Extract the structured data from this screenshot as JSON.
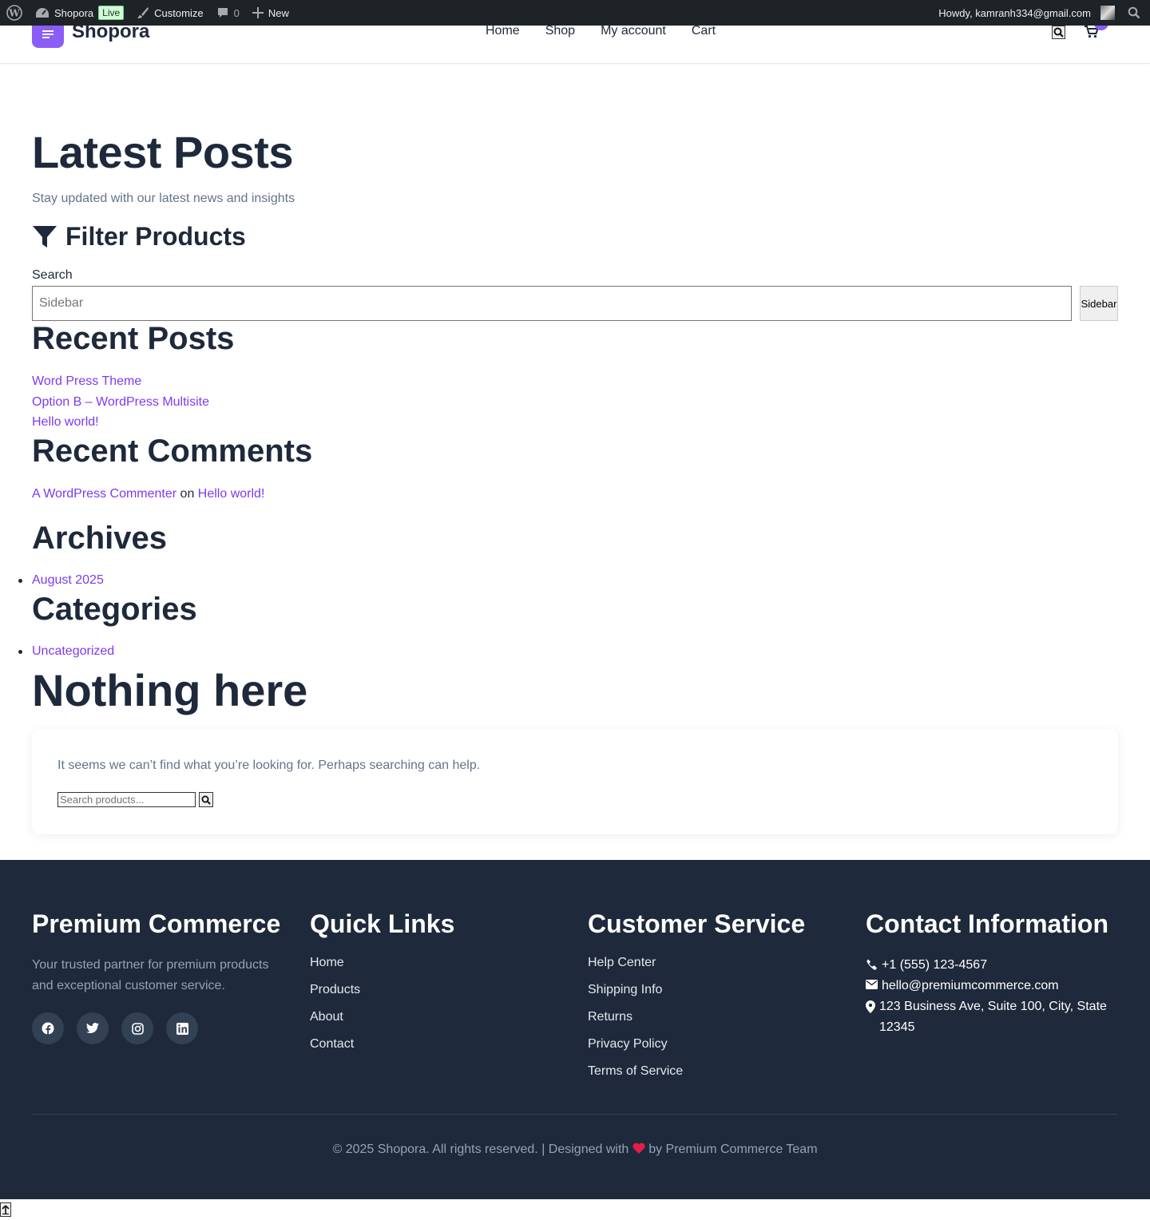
{
  "adminbar": {
    "site_name": "Shopora",
    "live_badge": "Live",
    "customize": "Customize",
    "comments_count": "0",
    "new": "New",
    "howdy": "Howdy, kamranh334@gmail.com"
  },
  "header": {
    "logo": "Shopora",
    "nav": [
      "Home",
      "Shop",
      "My account",
      "Cart"
    ]
  },
  "main": {
    "title": "Latest Posts",
    "subtitle": "Stay updated with our latest news and insights",
    "filter_heading": "Filter Products",
    "search_label": "Search",
    "search_placeholder": "Sidebar",
    "search_button": "Sidebar",
    "recent_posts_heading": "Recent Posts",
    "recent_posts": [
      "Word Press Theme",
      "Option B – WordPress Multisite",
      "Hello world!"
    ],
    "recent_comments_heading": "Recent Comments",
    "comment_author": "A WordPress Commenter",
    "comment_on": "on",
    "comment_post": "Hello world!",
    "archives_heading": "Archives",
    "archives": [
      "August 2025"
    ],
    "categories_heading": "Categories",
    "categories": [
      "Uncategorized"
    ],
    "nothing_heading": "Nothing here",
    "nothing_text": "It seems we can’t find what you’re looking for. Perhaps searching can help.",
    "nothing_search_placeholder": "Search products..."
  },
  "footer": {
    "brand_heading": "Premium Commerce",
    "brand_desc": "Your trusted partner for premium products and exceptional customer service.",
    "socials": [
      "facebook-icon",
      "twitter-icon",
      "instagram-icon",
      "linkedin-icon"
    ],
    "quick_heading": "Quick Links",
    "quick_links": [
      "Home",
      "Products",
      "About",
      "Contact"
    ],
    "service_heading": "Customer Service",
    "service_links": [
      "Help Center",
      "Shipping Info",
      "Returns",
      "Privacy Policy",
      "Terms of Service"
    ],
    "contact_heading": "Contact Information",
    "phone": "+1 (555) 123-4567",
    "email": "hello@premiumcommerce.com",
    "address": "123 Business Ave, Suite 100, City, State 12345",
    "copyright_a": "© 2025 Shopora. All rights reserved. | Designed with",
    "copyright_b": "by Premium Commerce Team"
  },
  "colors": {
    "accent": "#8b5cf6",
    "link": "#7e3af2",
    "heading": "#1e293b",
    "footer_bg": "#1e293b",
    "heart": "#e11d48"
  }
}
